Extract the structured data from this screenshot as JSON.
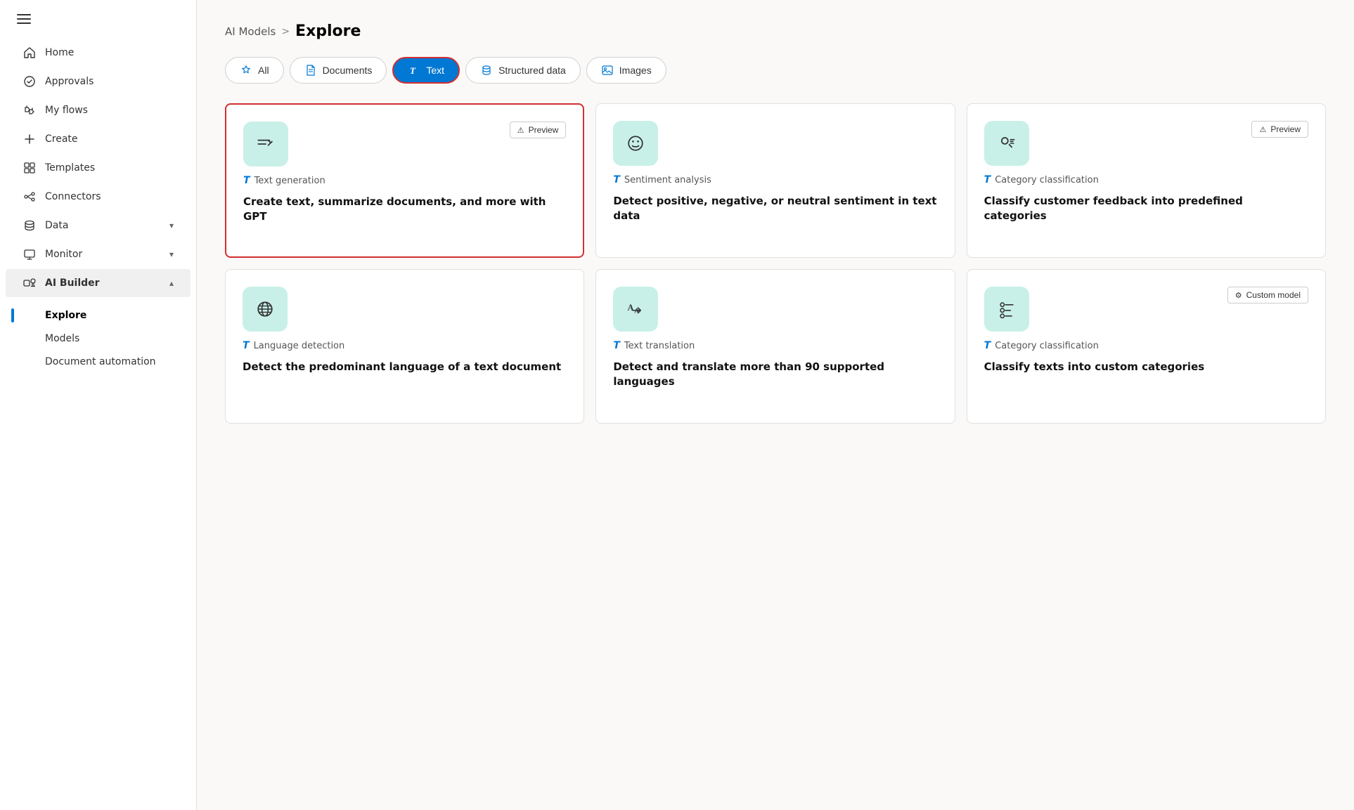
{
  "sidebar": {
    "nav_items": [
      {
        "id": "home",
        "label": "Home",
        "icon": "home"
      },
      {
        "id": "approvals",
        "label": "Approvals",
        "icon": "approvals"
      },
      {
        "id": "my-flows",
        "label": "My flows",
        "icon": "flows"
      },
      {
        "id": "create",
        "label": "Create",
        "icon": "create"
      },
      {
        "id": "templates",
        "label": "Templates",
        "icon": "templates"
      },
      {
        "id": "connectors",
        "label": "Connectors",
        "icon": "connectors"
      },
      {
        "id": "data",
        "label": "Data",
        "icon": "data",
        "chevron": "▾"
      },
      {
        "id": "monitor",
        "label": "Monitor",
        "icon": "monitor",
        "chevron": "▾"
      },
      {
        "id": "ai-builder",
        "label": "AI Builder",
        "icon": "ai-builder",
        "chevron": "▴",
        "active": true
      }
    ],
    "ai_builder_subitems": [
      {
        "id": "explore",
        "label": "Explore",
        "active": true
      },
      {
        "id": "models",
        "label": "Models"
      },
      {
        "id": "document-automation",
        "label": "Document automation"
      }
    ]
  },
  "breadcrumb": {
    "parent": "AI Models",
    "separator": ">",
    "current": "Explore"
  },
  "filter_tabs": [
    {
      "id": "all",
      "label": "All",
      "icon_type": "star"
    },
    {
      "id": "documents",
      "label": "Documents",
      "icon_type": "document"
    },
    {
      "id": "text",
      "label": "Text",
      "icon_type": "text",
      "active": true
    },
    {
      "id": "structured-data",
      "label": "Structured data",
      "icon_type": "database"
    },
    {
      "id": "images",
      "label": "Images",
      "icon_type": "image"
    }
  ],
  "cards": [
    {
      "id": "text-generation",
      "type_label": "Text generation",
      "title": "Create text, summarize documents, and more with GPT",
      "badge": "Preview",
      "selected": true,
      "icon_type": "text-gen"
    },
    {
      "id": "sentiment-analysis",
      "type_label": "Sentiment analysis",
      "title": "Detect positive, negative, or neutral sentiment in text data",
      "badge": null,
      "selected": false,
      "icon_type": "sentiment"
    },
    {
      "id": "category-classification-1",
      "type_label": "Category classification",
      "title": "Classify customer feedback into predefined categories",
      "badge": "Preview",
      "selected": false,
      "icon_type": "category"
    },
    {
      "id": "language-detection",
      "type_label": "Language detection",
      "title": "Detect the predominant language of a text document",
      "badge": null,
      "selected": false,
      "icon_type": "globe"
    },
    {
      "id": "text-translation",
      "type_label": "Text translation",
      "title": "Detect and translate more than 90 supported languages",
      "badge": null,
      "selected": false,
      "icon_type": "translation"
    },
    {
      "id": "category-classification-2",
      "type_label": "Category classification",
      "title": "Classify texts into custom categories",
      "badge": "Custom model",
      "selected": false,
      "icon_type": "custom-category"
    }
  ],
  "labels": {
    "preview": "Preview",
    "custom_model": "Custom model",
    "text_type": "T"
  }
}
